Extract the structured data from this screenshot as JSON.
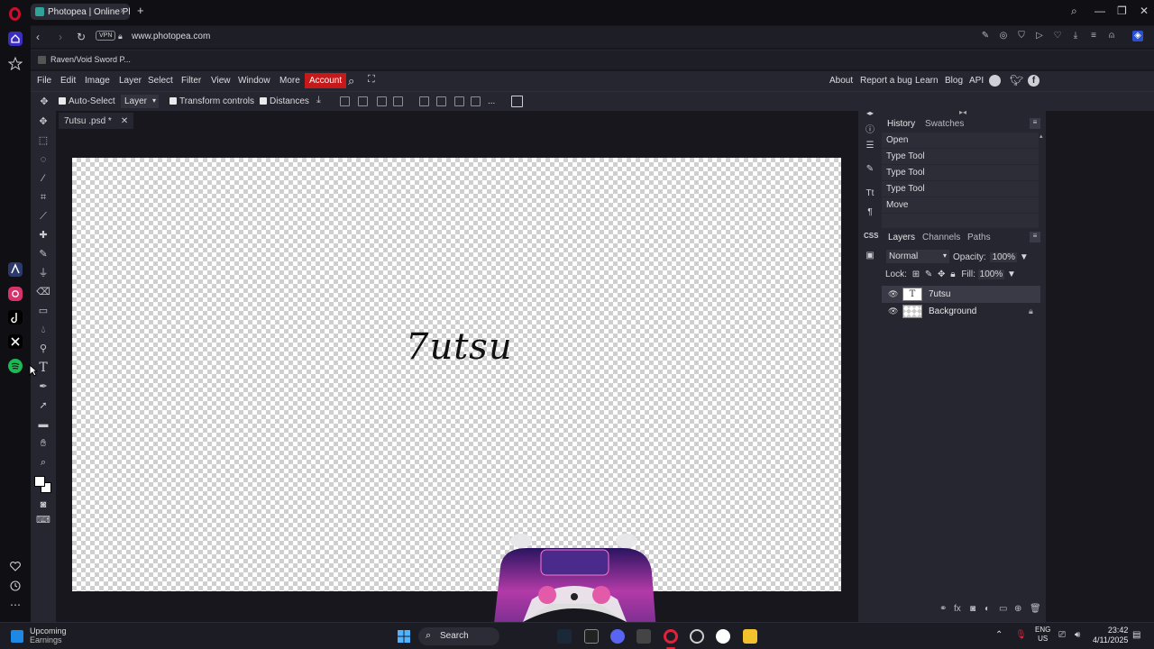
{
  "browser": {
    "tab_title": "Photopea | Online Photo E",
    "url": "www.photopea.com",
    "vpn_label": "VPN",
    "bookmark": "Raven/Void Sword P..."
  },
  "menu": {
    "items": [
      "File",
      "Edit",
      "Image",
      "Layer",
      "Select",
      "Filter",
      "View",
      "Window",
      "More"
    ],
    "account": "Account",
    "right_links": [
      "About",
      "Report a bug",
      "Learn",
      "Blog",
      "API"
    ]
  },
  "options": {
    "auto_select": "Auto-Select",
    "layer_select": "Layer",
    "transform_controls": "Transform controls",
    "distances": "Distances",
    "more": "..."
  },
  "document": {
    "tab_title": "7utsu .psd *",
    "canvas_text": "7utsu"
  },
  "history": {
    "tabs": [
      "History",
      "Swatches"
    ],
    "items": [
      "Open",
      "Type Tool",
      "Type Tool",
      "Type Tool",
      "Move"
    ]
  },
  "layers_panel": {
    "tabs": [
      "Layers",
      "Channels",
      "Paths"
    ],
    "blend_mode": "Normal",
    "opacity_label": "Opacity:",
    "opacity_value": "100%",
    "lock_label": "Lock:",
    "fill_label": "Fill:",
    "fill_value": "100%",
    "layers": [
      {
        "name": "7utsu",
        "thumb": "T"
      },
      {
        "name": "Background",
        "thumb": ""
      }
    ]
  },
  "taskbar": {
    "weather_title": "Upcoming",
    "weather_sub": "Earnings",
    "search": "Search",
    "lang_top": "ENG",
    "lang_bottom": "US",
    "time": "23:42",
    "date": "4/11/2025"
  },
  "colors": {
    "accent_red": "#c61a1a",
    "panel_bg": "#262630",
    "workspace_bg": "#17171d"
  }
}
